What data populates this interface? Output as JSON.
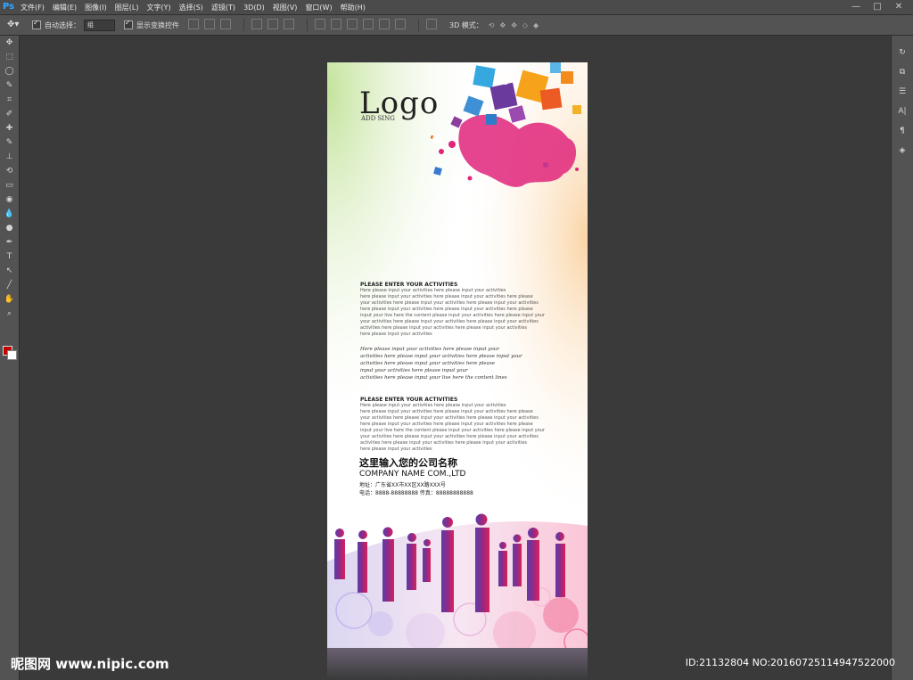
{
  "app": {
    "logo": "Ps"
  },
  "menu": [
    "文件(F)",
    "编辑(E)",
    "图像(I)",
    "图层(L)",
    "文字(Y)",
    "选择(S)",
    "滤镜(T)",
    "3D(D)",
    "视图(V)",
    "窗口(W)",
    "帮助(H)"
  ],
  "window_controls": [
    "—",
    "□",
    "✕"
  ],
  "options_bar": {
    "auto_select_label": "自动选择：",
    "auto_select_value": "组",
    "show_transform_label": "显示变换控件",
    "mode_3d_label": "3D 模式："
  },
  "toolbar_icons": [
    "move-icon",
    "marquee-icon",
    "lasso-icon",
    "quick-select-icon",
    "crop-icon",
    "eyedropper-icon",
    "healing-icon",
    "brush-icon",
    "stamp-icon",
    "history-brush-icon",
    "eraser-icon",
    "bucket-icon",
    "blur-icon",
    "dodge-icon",
    "pen-icon",
    "type-icon",
    "path-select-icon",
    "line-icon",
    "hand-icon",
    "zoom-icon"
  ],
  "toolbar_glyphs": [
    "✥",
    "⬚",
    "◯",
    "✎",
    "⌗",
    "✐",
    "✚",
    "✎",
    "⊥",
    "⟲",
    "▭",
    "◉",
    "💧",
    "●",
    "✒",
    "T",
    "↖",
    "╱",
    "✋",
    "⌕"
  ],
  "right_panel_icons": [
    "history-icon",
    "adjust-icon",
    "properties-icon",
    "character-icon",
    "paragraph-icon",
    "3d-icon"
  ],
  "right_panel_glyphs": [
    "↻",
    "⧉",
    "☰",
    "A|",
    "¶",
    "◈"
  ],
  "poster": {
    "logo": "Logo",
    "logo_sub": "ADD SING",
    "heading1": "PLEASE ENTER YOUR ACTIVITIES",
    "para1": "Here please input your activities here please input your activities\nhere please input your activities here please input your activities here please\nyour activities here please input your activities here please input your activities\nhere please input your activities here please input your activities here please\ninput your live here the content please input your activities here please input your\nyour activities here please input your activities here please input your activities\n activities here please input your activities here please input your activities\nhere please input your activities",
    "script": "Here please input your activities here please input your\nactivities here please input your activities here please input your\nactivities here please input your activities here please\ninput your activities here please input your\nactivities here please input your live here the content lines",
    "heading2": "PLEASE ENTER YOUR ACTIVITIES",
    "para2": "Here please input your activities here please input your activities\nhere please input your activities here please input your activities here please\nyour activities here please input your activities here please input your activities\nhere please input your activities here please input your activities here please\ninput your live here the content please input your activities here please input your\nyour activities here please input your activities here please input your activities\n activities here please input your activities here please input your activities\nhere please input your activities",
    "company_cn": "这里输入您的公司名称",
    "company_en": "COMPANY NAME COM.,LTD",
    "address": "地址：广东省XX市XX区XX路XXX号",
    "phone": "电话：8888-88888888 传真：88888888888"
  },
  "watermark": {
    "left": "昵图网 www.nipic.com",
    "right": "ID:21132804 NO:20160725114947522000"
  }
}
